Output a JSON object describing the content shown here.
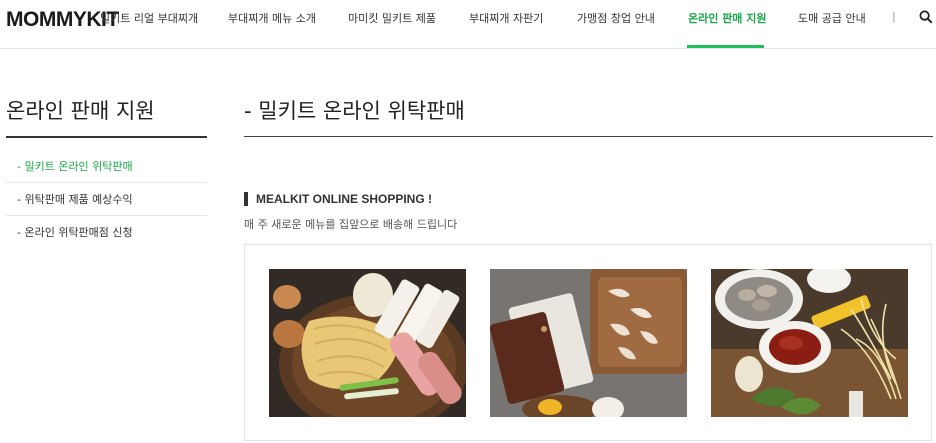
{
  "header": {
    "logo": "MOMMYKIT",
    "nav": [
      "밀키트 리얼 부대찌개",
      "부대찌개 메뉴 소개",
      "마미킷 밀키트 제품",
      "부대찌개 자판기",
      "가맹점 창업 안내",
      "온라인 판매 지원",
      "도매 공급 안내"
    ],
    "separator": "|",
    "active_index": 5
  },
  "sidebar": {
    "title": "온라인 판매 지원",
    "items": [
      "- 밀키트 온라인 위탁판매",
      "- 위탁판매 제품 예상수익",
      "- 온라인 위탁판매점 신청"
    ]
  },
  "main": {
    "title": "- 밀키트 온라인 위탁판매",
    "section_title": "MEALKIT ONLINE SHOPPING !",
    "section_subtitle": "매 주 새로운 메뉴를 집앞으로 배송해 드립니다"
  },
  "products": [
    {
      "image": "noodles-tteok-sausage-eggs-photo"
    },
    {
      "image": "sauce-pack-shrimp-tray-photo"
    },
    {
      "image": "mushrooms-sprouts-pepper-paste-photo"
    }
  ],
  "colors": {
    "accent": "#1aa64b",
    "text": "#222222"
  }
}
